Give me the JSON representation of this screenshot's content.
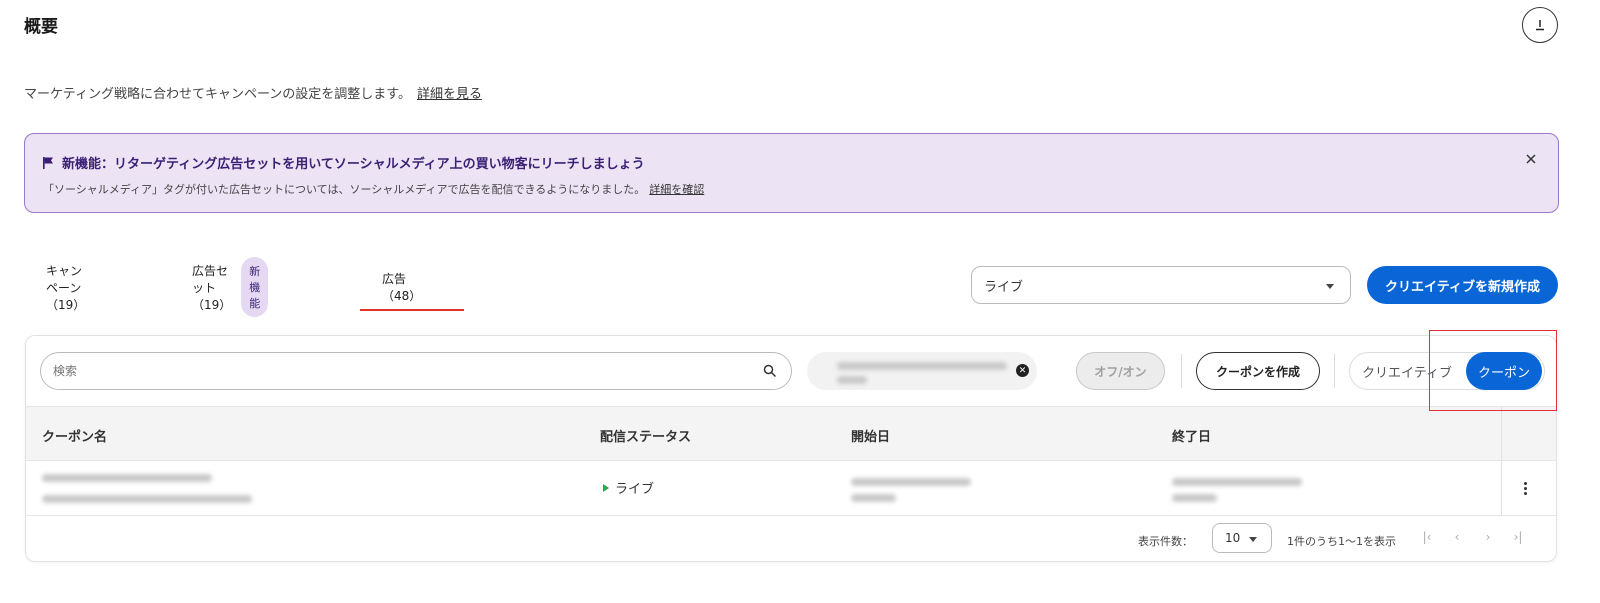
{
  "header": {
    "title": "概要",
    "download_icon": "download-icon"
  },
  "intro": {
    "text": "マーケティング戦略に合わせてキャンペーンの設定を調整します。",
    "link": "詳細を見る"
  },
  "banner": {
    "title": "新機能：リターゲティング広告セットを用いてソーシャルメディア上の買い物客にリーチしましょう",
    "text": "「ソーシャルメディア」タグが付いた広告セットについては、ソーシャルメディアで広告を配信できるようになりました。",
    "link": "詳細を確認",
    "icon": "flag-icon",
    "bg_color": "#ece3f5",
    "border_color": "#9b78c9"
  },
  "tabs": [
    {
      "label": "キャンペーン（19）"
    },
    {
      "label": "広告セット（19）",
      "badge": "新機能"
    },
    {
      "label": "広告（48）",
      "active": true
    }
  ],
  "status_filter": {
    "value": "ライブ"
  },
  "primary_action": {
    "label": "クリエイティブを新規作成",
    "color": "#0a66d6"
  },
  "toolbar": {
    "search_placeholder": "検索",
    "offon_label": "オフ/オン",
    "create_coupon_label": "クーポンを作成",
    "view_toggle": {
      "options": [
        "クリエイティブ",
        "クーポン"
      ],
      "selected": "クーポン"
    }
  },
  "table": {
    "columns": [
      "クーポン名",
      "配信ステータス",
      "開始日",
      "終了日"
    ],
    "rows": [
      {
        "status": "ライブ",
        "status_color": "#2aa84a"
      }
    ]
  },
  "pagination": {
    "rows_label": "表示件数：",
    "rows_per_page": "10",
    "range_text": "1件のうち1～1を表示"
  },
  "highlight_color": "#e0303b"
}
